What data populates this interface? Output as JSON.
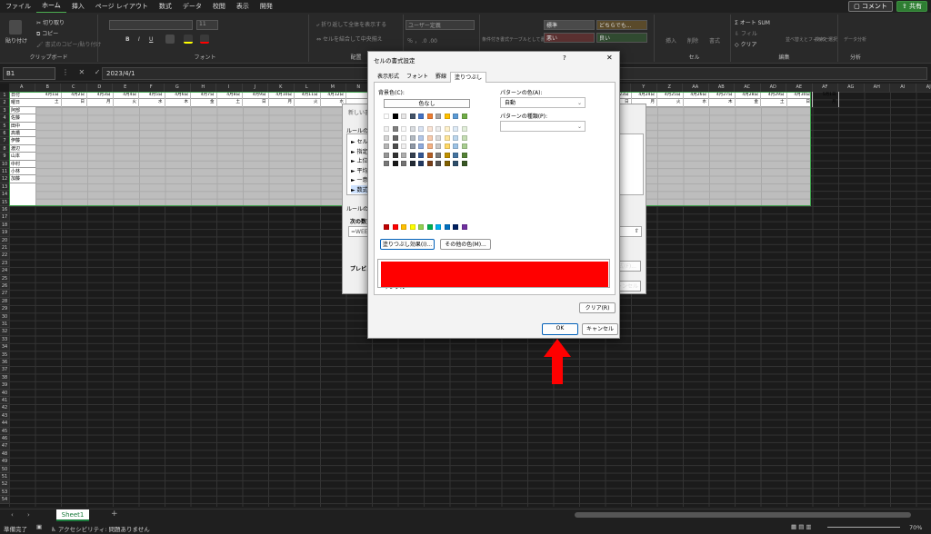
{
  "menu": {
    "tabs": [
      "ファイル",
      "ホーム",
      "挿入",
      "ページ レイアウト",
      "数式",
      "データ",
      "校閲",
      "表示",
      "開発"
    ],
    "active": "ホーム",
    "comment": "コメント",
    "share": "共有"
  },
  "ribbon": {
    "clipboard": {
      "label": "クリップボード",
      "paste": "貼り付け",
      "cut": "切り取り",
      "copy": "コピー",
      "format_painter": "書式のコピー/貼り付け"
    },
    "font": {
      "label": "フォント",
      "size": "11"
    },
    "alignment": {
      "label": "配置",
      "wrap": "折り返して全体を表示する",
      "merge": "セルを結合して中央揃え"
    },
    "number": {
      "label": "数値",
      "format": "ユーザー定義"
    },
    "styles": {
      "label": "スタイル",
      "cond": "条件付き書式",
      "table": "テーブルとして書式設定",
      "standard": "標準",
      "neutral": "どちらでも...",
      "bad": "悪い",
      "good": "良い"
    },
    "cells": {
      "label": "セル",
      "insert": "挿入",
      "delete": "削除",
      "format": "書式"
    },
    "editing": {
      "label": "編集",
      "autosum": "オート SUM",
      "fill": "フィル",
      "clear": "クリア",
      "sort": "並べ替えとフィルター",
      "find": "検索と選択"
    },
    "analysis": {
      "label": "分析",
      "data_analysis": "データ分析"
    }
  },
  "formula": {
    "namebox": "B1",
    "fx": "fx",
    "value": "2023/4/1"
  },
  "sheet": {
    "columns": [
      "A",
      "B",
      "C",
      "D",
      "E",
      "F",
      "G",
      "H",
      "I",
      "J",
      "K",
      "L",
      "M",
      "N",
      "O",
      "P",
      "Q",
      "R",
      "S",
      "T",
      "U",
      "V",
      "W",
      "X",
      "Y",
      "Z",
      "AA",
      "AB",
      "AC",
      "AD",
      "AE",
      "AF",
      "AG",
      "AH",
      "AI",
      "AJ"
    ],
    "rows": [
      "1",
      "2",
      "3",
      "4",
      "5",
      "6",
      "7",
      "8",
      "9",
      "10",
      "11",
      "12",
      "13",
      "14",
      "15",
      "16",
      "17",
      "18",
      "19",
      "20",
      "21",
      "22",
      "23",
      "24",
      "25",
      "26",
      "27",
      "28",
      "29",
      "30",
      "31",
      "32",
      "33",
      "34",
      "35",
      "36",
      "37",
      "38",
      "39",
      "40",
      "41",
      "42",
      "43",
      "44",
      "45",
      "46",
      "47",
      "48",
      "49",
      "50",
      "51",
      "52",
      "53",
      "54"
    ],
    "names": [
      "日付",
      "曜日",
      "阿部",
      "佐藤",
      "田中",
      "高橋",
      "伊藤",
      "渡辺",
      "山本",
      "中村",
      "小林",
      "加藤"
    ],
    "dates": [
      "4月1日",
      "4月2日",
      "4月3日",
      "4月4日",
      "4月5日",
      "4月6日",
      "4月7日",
      "4月8日",
      "4月9日",
      "4月10日",
      "4月11日",
      "4月12日",
      "",
      "",
      "",
      "",
      "",
      "",
      "",
      "",
      "",
      "",
      "4月23日",
      "4月24日",
      "4月25日",
      "4月26日",
      "4月27日",
      "4月28日",
      "4月29日",
      "4月30日",
      "5月1日"
    ],
    "days": [
      "土",
      "日",
      "月",
      "火",
      "水",
      "木",
      "金",
      "土",
      "日",
      "月",
      "火",
      "水",
      "",
      "",
      "",
      "",
      "",
      "",
      "",
      "",
      "",
      "",
      "日",
      "月",
      "火",
      "水",
      "木",
      "金",
      "土",
      "日",
      "月"
    ]
  },
  "bg_dialog": {
    "title": "新しい書式ルール",
    "rule_type": "ルールの種類",
    "items": [
      "セルの値に基づいてすべてのセルを書式設定",
      "指定の値を含むセルだけを書式設定",
      "上位または下位に入る値だけを書式設定",
      "平均より上または下の値だけを書式設定",
      "一意の値または重複する値だけを書式設定",
      "数式を使用して、書式設定するセルを決定"
    ],
    "rule_desc": "ルールの内容を編集してください",
    "formula_label": "次の数式を満たす場合に値を書式設定",
    "formula": "=WEEKDAY(B$2)",
    "preview": "プレビュー",
    "format_btn": "書式(F)...",
    "cancel": "キャンセル"
  },
  "dialog": {
    "title": "セルの書式設定",
    "help": "?",
    "close": "✕",
    "tabs": [
      "表示形式",
      "フォント",
      "罫線",
      "塗りつぶし"
    ],
    "active_tab": "塗りつぶし",
    "bg_color_label": "背景色(C):",
    "no_color": "色なし",
    "pattern_color_label": "パターンの色(A):",
    "pattern_color_value": "自動",
    "pattern_type_label": "パターンの種類(P):",
    "fill_effects": "塗りつぶし効果(I)...",
    "more_colors": "その他の色(M)...",
    "sample": "サンプル",
    "clear": "クリア(R)",
    "ok": "OK",
    "cancel": "キャンセル",
    "sample_color": "#ff0000"
  },
  "palette": {
    "theme_top": [
      "#ffffff",
      "#000000",
      "#e7e6e6",
      "#44546a",
      "#4472c4",
      "#ed7d31",
      "#a5a5a5",
      "#ffc000",
      "#5b9bd5",
      "#70ad47"
    ],
    "standard": [
      "#c00000",
      "#ff0000",
      "#ffc000",
      "#ffff00",
      "#92d050",
      "#00b050",
      "#00b0f0",
      "#0070c0",
      "#002060",
      "#7030a0"
    ]
  },
  "tabs_bar": {
    "sheet": "Sheet1",
    "add": "+"
  },
  "status": {
    "ready": "準備完了",
    "accessibility": "アクセシビリティ: 問題ありません",
    "zoom": "70%"
  }
}
